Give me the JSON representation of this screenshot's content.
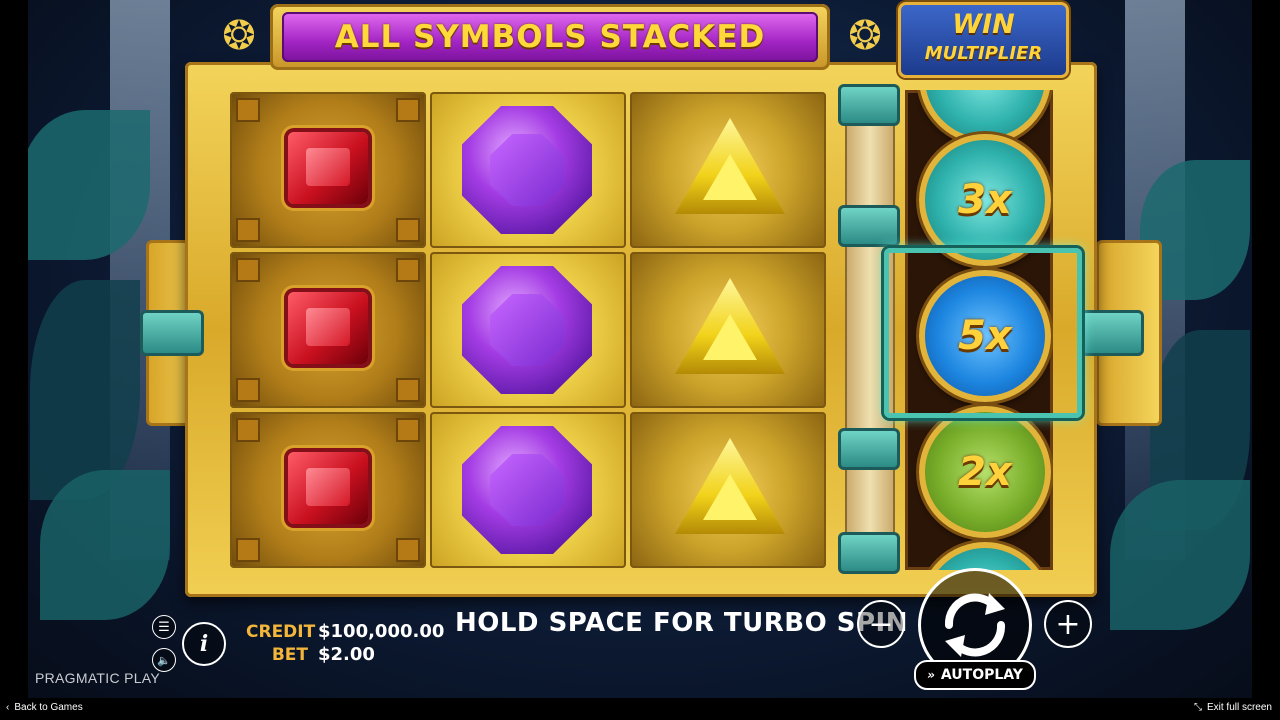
{
  "header": {
    "banner_text": "ALL SYMBOLS STACKED",
    "badge_line1": "WIN",
    "badge_line2": "MULTIPLIER"
  },
  "reels": {
    "columns": [
      {
        "symbol": "ruby-gem",
        "rows": 3
      },
      {
        "symbol": "amethyst-gem",
        "rows": 3
      },
      {
        "symbol": "gold-triangle",
        "rows": 3
      }
    ]
  },
  "multiplier_reel": {
    "visible": [
      "3x",
      "5x",
      "2x"
    ],
    "selected": "5x",
    "colors": {
      "3x": "#2fb2ad",
      "5x": "#1d86e0",
      "2x": "#79ae2a"
    }
  },
  "controls": {
    "credit_label": "CREDIT",
    "credit_value": "$100,000.00",
    "bet_label": "BET",
    "bet_value": "$2.00",
    "turbo_message": "HOLD SPACE FOR TURBO SPIN",
    "autoplay_label": "AUTOPLAY",
    "info_glyph": "i",
    "minus_glyph": "−",
    "plus_glyph": "+",
    "menu_glyph": "☰",
    "sound_glyph": "🔈"
  },
  "footer": {
    "brand": "PRAGMATIC PLAY",
    "back_label": "Back to Games",
    "exit_label": "Exit full screen"
  },
  "colors": {
    "accent_gold": "#f3b53a",
    "banner_purple": "#a224c4",
    "frame_gold": "#d9a92a"
  }
}
